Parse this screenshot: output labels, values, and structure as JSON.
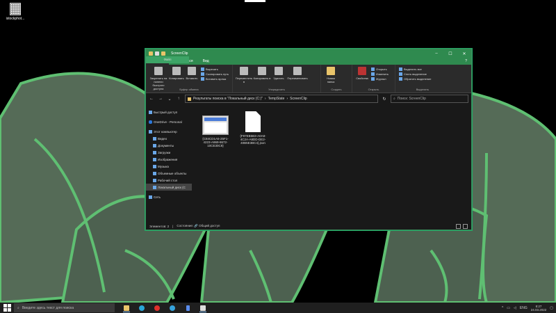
{
  "desktop": {
    "icon_label": "istockphot..."
  },
  "window": {
    "title": "ScreenClip",
    "controls": {
      "minimize": "–",
      "maximize": "☐",
      "close": "✕"
    },
    "tabs": [
      "Файл",
      "Главная",
      "Поделиться",
      "Вид"
    ],
    "ribbon": {
      "clipboard": {
        "pin": "Закрепить на панели быстрого доступа",
        "copy": "Копировать",
        "paste": "Вставить",
        "cut": "Вырезать",
        "copy_path": "Скопировать путь",
        "paste_shortcut": "Вставить ярлык",
        "group": "Буфер обмена"
      },
      "organize": {
        "move": "Переместить в",
        "copy_to": "Копировать в",
        "delete": "Удалить",
        "rename": "Переименовать",
        "group": "Упорядочить"
      },
      "create": {
        "new_folder": "Новая папка",
        "group": "Создать"
      },
      "open": {
        "properties": "Свойства",
        "open": "Открыть",
        "edit": "Изменить",
        "history": "Журнал",
        "group": "Открыть"
      },
      "select": {
        "select_all": "Выделить все",
        "select_none": "Снять выделение",
        "invert": "Обратить выделение",
        "group": "Выделить"
      }
    },
    "address": {
      "crumbs": [
        "Результаты поиска в \"Локальный диск (C:)\"",
        "TempState",
        "ScreenClip"
      ],
      "search_placeholder": "Поиск: ScreenClip"
    },
    "nav": [
      {
        "label": "Быстрый доступ"
      },
      {
        "label": "OneDrive - Personal"
      },
      {
        "label": "Этот компьютер"
      },
      {
        "label": "Видео"
      },
      {
        "label": "Документы"
      },
      {
        "label": "Загрузки"
      },
      {
        "label": "Изображения"
      },
      {
        "label": "Музыка"
      },
      {
        "label": "Объемные объекты"
      },
      {
        "label": "Рабочий стол"
      },
      {
        "label": "Локальный диск (C"
      },
      {
        "label": "Сеть"
      }
    ],
    "files": [
      {
        "name": "{C84CD1A5-25F1-4223-A969-8672-10CE30C9}"
      },
      {
        "name": "{F97EB5B3-A0A8-4C2A-A8DD-DE2-40B5E3BC4}.json"
      }
    ],
    "status": {
      "count": "Элементов: 2",
      "state": "Состояние: 🔗 Общий доступ"
    }
  },
  "taskbar": {
    "search_placeholder": "Введите здесь текст для поиска",
    "lang": "ENG",
    "time": "8:27",
    "date": "24.03.2022"
  }
}
